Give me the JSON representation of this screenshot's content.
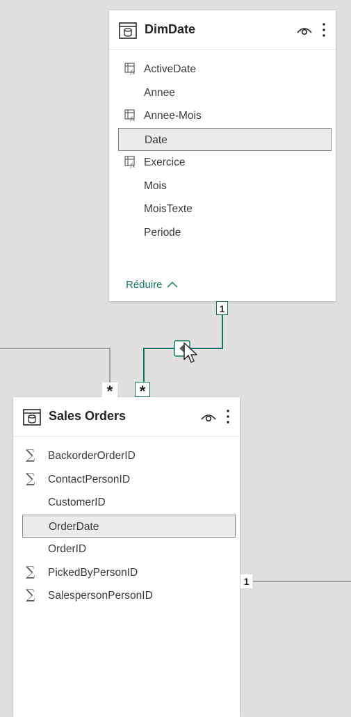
{
  "tables": {
    "dimdate": {
      "title": "DimDate",
      "collapse_label": "Réduire",
      "fields": [
        {
          "label": "ActiveDate",
          "icon": "calculated-column-icon",
          "selected": false
        },
        {
          "label": "Annee",
          "icon": "",
          "selected": false
        },
        {
          "label": "Annee-Mois",
          "icon": "calculated-column-icon",
          "selected": false
        },
        {
          "label": "Date",
          "icon": "",
          "selected": true
        },
        {
          "label": "Exercice",
          "icon": "calculated-column-icon",
          "selected": false
        },
        {
          "label": "Mois",
          "icon": "",
          "selected": false
        },
        {
          "label": "MoisTexte",
          "icon": "",
          "selected": false
        },
        {
          "label": "Periode",
          "icon": "",
          "selected": false
        }
      ]
    },
    "sales_orders": {
      "title": "Sales Orders",
      "fields": [
        {
          "label": "BackorderOrderID",
          "icon": "sigma-icon",
          "selected": false
        },
        {
          "label": "ContactPersonID",
          "icon": "sigma-icon",
          "selected": false
        },
        {
          "label": "CustomerID",
          "icon": "",
          "selected": false
        },
        {
          "label": "OrderDate",
          "icon": "",
          "selected": true
        },
        {
          "label": "OrderID",
          "icon": "",
          "selected": false
        },
        {
          "label": "PickedByPersonID",
          "icon": "sigma-icon",
          "selected": false
        },
        {
          "label": "SalespersonPersonID",
          "icon": "sigma-icon",
          "selected": false
        }
      ]
    }
  },
  "relationships": {
    "dimdate_one": "1",
    "left_many": "*",
    "dimdate_many": "*",
    "right_one": "1"
  },
  "colors": {
    "canvas": "#e1e0df",
    "active_relationship": "#117865",
    "inactive_relationship": "#8a8886",
    "selected_field_bg": "#ebebeb"
  }
}
